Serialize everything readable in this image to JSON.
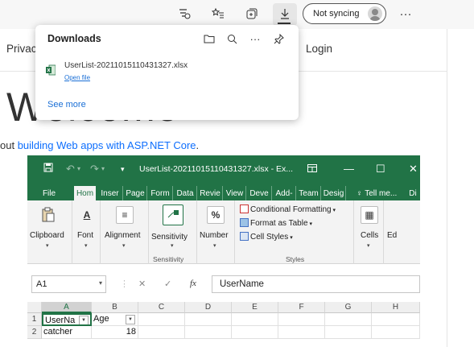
{
  "browser": {
    "sync_label": "Not syncing",
    "icons": [
      "tracking-prevention-icon",
      "favorites-icon",
      "collections-icon",
      "downloads-icon",
      "more-icon"
    ]
  },
  "page": {
    "nav_privacy": "Privac",
    "nav_login": "Login",
    "welcome": "Welcome",
    "learn_prefix": "out ",
    "learn_link": "building Web apps with ASP.NET Core",
    "learn_suffix": "."
  },
  "downloads": {
    "title": "Downloads",
    "file_name": "UserList-20211015110431327.xlsx",
    "open_file": "Open file",
    "see_more": "See more"
  },
  "excel": {
    "title": "UserList-20211015110431327.xlsx  -  Ex...",
    "tabs": [
      "File",
      "Hom",
      "Inser",
      "Page",
      "Form",
      "Data",
      "Revie",
      "View",
      "Deve",
      "Add-",
      "Team",
      "Desig",
      "Tell me...",
      "Di"
    ],
    "ribbon": {
      "clipboard": "Clipboard",
      "font": "Font",
      "alignment": "Alignment",
      "sensitivity": "Sensitivity",
      "sensitivity_group": "Sensitivity",
      "number": "Number",
      "conditional": "Conditional Formatting",
      "format_table": "Format as Table",
      "cell_styles": "Cell Styles",
      "styles_group": "Styles",
      "cells": "Cells",
      "editing": "Ed"
    },
    "name_box": "A1",
    "fx": "fx",
    "formula": "UserName",
    "columns": [
      "A",
      "B",
      "C",
      "D",
      "E",
      "F",
      "G",
      "H"
    ],
    "rows": [
      {
        "num": "1",
        "a": "UserNa",
        "b": "Age"
      },
      {
        "num": "2",
        "a": "catcher",
        "b": "18"
      }
    ],
    "accent": "#217346"
  }
}
